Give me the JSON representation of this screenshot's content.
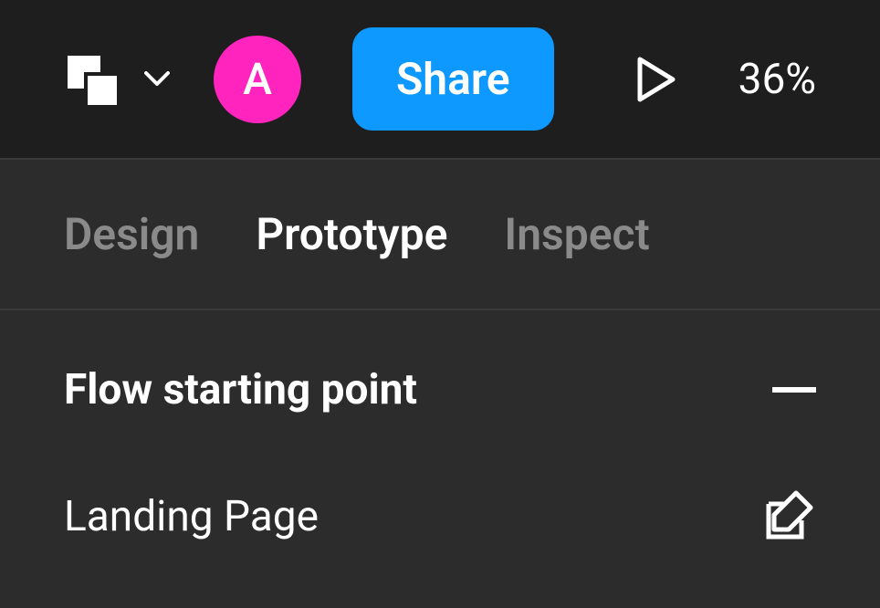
{
  "toolbar": {
    "avatar_initial": "A",
    "avatar_color": "#ff24bd",
    "share_label": "Share",
    "zoom_level": "36%"
  },
  "tabs": {
    "design": "Design",
    "prototype": "Prototype",
    "inspect": "Inspect",
    "active": "prototype"
  },
  "panel": {
    "section_title": "Flow starting point",
    "flow_name": "Landing Page"
  }
}
